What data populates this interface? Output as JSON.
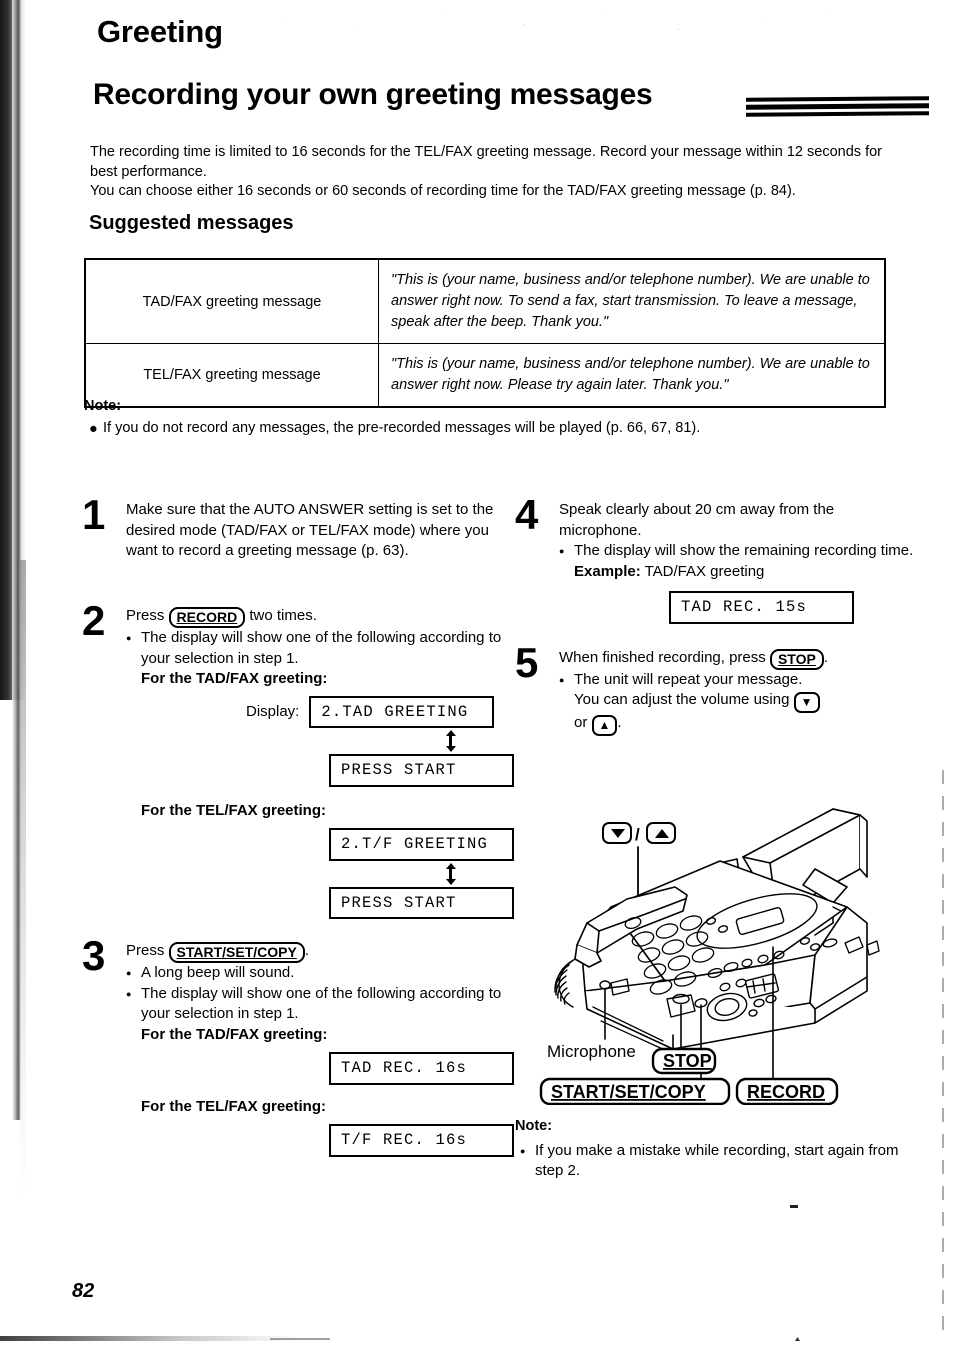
{
  "header": {
    "section_title": "Greeting",
    "main_title": "Recording your own greeting messages",
    "intro_line1": "The recording time is limited to 16 seconds for the TEL/FAX greeting message. Record your message within 12 seconds for best performance.",
    "intro_line2": "You can choose either 16 seconds or 60 seconds of recording time for the TAD/FAX greeting message (p. 84).",
    "subsection_title": "Suggested messages"
  },
  "suggested_table": {
    "rows": [
      {
        "label": "TAD/FAX greeting message",
        "message": "\"This is (your name, business and/or telephone number). We are unable to answer right now. To send a fax, start transmission. To leave a message, speak after the beep. Thank you.\""
      },
      {
        "label": "TEL/FAX greeting message",
        "message": "\"This is (your name, business and/or telephone number). We are unable to answer right now. Please try again later. Thank you.\""
      }
    ]
  },
  "note_top": {
    "heading": "Note:",
    "bullet": "If you do not record any messages, the pre-recorded messages will be played (p. 66, 67, 81)."
  },
  "steps": {
    "step1": {
      "number": "1",
      "text": "Make sure that the AUTO ANSWER setting is set to the desired mode (TAD/FAX or TEL/FAX mode) where you want to record a greeting message (p. 63)."
    },
    "step2": {
      "number": "2",
      "press_word": "Press",
      "button": "RECORD",
      "after_button": "two times.",
      "bullet": "The display will show one of the following according to your selection in step 1.",
      "tadfax_heading": "For the TAD/FAX greeting:",
      "display_label": "Display:",
      "tadfax_display_1": "2.TAD GREETING",
      "tadfax_display_2": "PRESS START",
      "telfax_heading": "For the TEL/FAX greeting:",
      "telfax_display_1": "2.T/F GREETING",
      "telfax_display_2": "PRESS START"
    },
    "step3": {
      "number": "3",
      "press_word": "Press",
      "button": "START/SET/COPY",
      "after_button": ".",
      "bullet1": "A long beep will sound.",
      "bullet2": "The display will show one of the following according to your selection in step 1.",
      "tadfax_heading": "For the TAD/FAX greeting:",
      "tadfax_display": "TAD    REC.    16s",
      "telfax_heading": "For the TEL/FAX greeting:",
      "telfax_display": "T/F    REC.    16s"
    },
    "step4": {
      "number": "4",
      "text": "Speak clearly about 20 cm away from the microphone.",
      "bullet": "The display will show the remaining recording time.",
      "example_label": "Example:",
      "example_value": "TAD/FAX greeting",
      "display": "TAD    REC.    15s"
    },
    "step5": {
      "number": "5",
      "lead": "When finished recording, press",
      "button": "STOP",
      "after_button": ".",
      "bullet_line1": "The unit will repeat your message.",
      "bullet_line2_a": "You can adjust the volume using",
      "down_arrow": "▼",
      "bullet_line2_b": "or",
      "up_arrow": "▲",
      "bullet_line2_c": "."
    }
  },
  "illustration": {
    "volume_down": "▼",
    "volume_slash": "/",
    "volume_up": "▲",
    "microphone_label": "Microphone",
    "stop_label": "STOP",
    "start_set_copy_label": "START/SET/COPY",
    "record_label": "RECORD"
  },
  "note_bottom": {
    "heading": "Note:",
    "bullet": "If you make a mistake while recording, start again from step 2."
  },
  "footer": {
    "page_number": "82"
  }
}
